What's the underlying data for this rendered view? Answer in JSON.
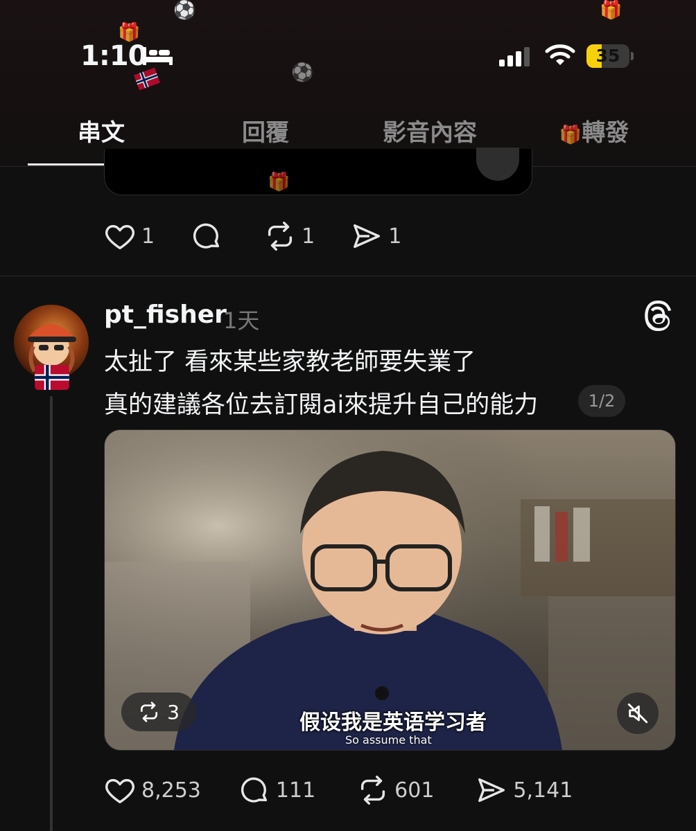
{
  "status_bar": {
    "time": "1:10",
    "battery_level": "35",
    "battery_color": "#f5d10c"
  },
  "tabs": [
    {
      "label": "串文",
      "active": true
    },
    {
      "label": "回覆",
      "active": false
    },
    {
      "label": "影音內容",
      "active": false
    },
    {
      "label": "轉發",
      "active": false
    }
  ],
  "previous_post": {
    "likes": "1",
    "replies": "",
    "reposts": "1",
    "shares": "1"
  },
  "post": {
    "username": "pt_fisher",
    "time": "1天",
    "lines": [
      "太扯了 看來某些家教老師要失業了",
      "真的建議各位去訂閱ai來提升自己的能力"
    ],
    "page_indicator": "1/2",
    "media": {
      "repost_count": "3",
      "subtitle_zh": "假设我是英语学习者",
      "subtitle_en": "So assume that"
    },
    "stats": {
      "likes": "8,253",
      "replies": "111",
      "reposts": "601",
      "shares": "5,141"
    }
  },
  "icons": [
    "bed-icon",
    "signal-icon",
    "wifi-icon",
    "heart-icon",
    "comment-icon",
    "repost-icon",
    "share-icon",
    "threads-logo-icon",
    "mute-icon",
    "norway-flag-icon"
  ]
}
